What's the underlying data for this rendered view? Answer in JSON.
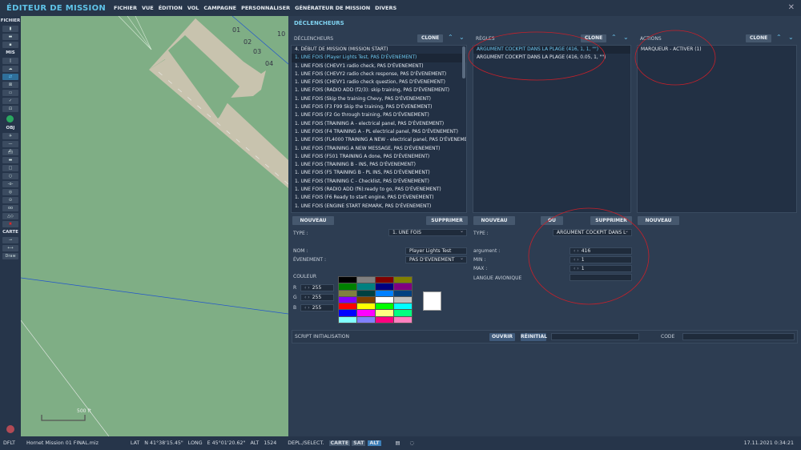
{
  "app": {
    "title": "ÉDITEUR DE MISSION",
    "menu": [
      "FICHIER",
      "VUE",
      "ÉDITION",
      "VOL",
      "CAMPAGNE",
      "PERSONNALISER",
      "GÉNÉRATEUR DE MISSION",
      "DIVERS"
    ],
    "close": "✕"
  },
  "toolbar": {
    "fichier": "FICHIER",
    "mis": "MIS",
    "obj": "OBJ",
    "carte": "CARTE",
    "draw": "Draw"
  },
  "map": {
    "parking": [
      "01",
      "02",
      "03",
      "04",
      "10"
    ],
    "scale": "500 ft"
  },
  "panel": {
    "title": "DÉCLENCHEURS",
    "triggers": {
      "label": "DÉCLENCHEURS",
      "clone": "CLONE",
      "items": [
        "4. DÉBUT DE MISSION (MISSION START)",
        "1. UNE FOIS (Player Lights Test, PAS D'ÉVENEMENT)",
        "1. UNE FOIS (CHEVY1 radio check, PAS D'ÉVENEMENT)",
        "1. UNE FOIS (CHEVY2 radio check response, PAS D'ÉVENEMENT)",
        "1. UNE FOIS (CHEVY1 radio check question, PAS D'ÉVENEMENT)",
        "1. UNE FOIS (RADIO ADD (f2/3): skip training, PAS D'ÉVENEMENT)",
        "1. UNE FOIS (Skip the training Chevy, PAS D'ÉVENEMENT)",
        "1. UNE FOIS (F3 F99 Skip the training, PAS D'ÉVENEMENT)",
        "1. UNE FOIS (F2 Go through training, PAS D'ÉVENEMENT)",
        "1. UNE FOIS (TRAINING A - electrical panel, PAS D'ÉVENEMENT)",
        "1. UNE FOIS (F4 TRAINING A - PL electrical panel, PAS D'ÉVENEMENT)",
        "1. UNE FOIS (FL4000 TRAINING A NEW - electrical panel, PAS D'ÉVENEMENT)",
        "1. UNE FOIS (TRAINING A NEW MESSAGE, PAS D'ÉVENEMENT)",
        "1. UNE FOIS (F501 TRAINING A done, PAS D'ÉVENEMENT)",
        "1. UNE FOIS (TRAINING B - INS, PAS D'ÉVENEMENT)",
        "1. UNE FOIS (F5 TRAINING B - PL INS, PAS D'ÉVENEMENT)",
        "1. UNE FOIS (TRAINING C - Checklist, PAS D'ÉVENEMENT)",
        "1. UNE FOIS (RADIO ADD (f6):ready to go, PAS D'ÉVENEMENT)",
        "1. UNE FOIS (F6 Ready to start engine, PAS D'ÉVENEMENT)",
        "1. UNE FOIS (ENGINE START REMARK, PAS D'ÉVENEMENT)"
      ],
      "selected": 1
    },
    "rules": {
      "label": "RÈGLES",
      "clone": "CLONE",
      "items": [
        "ARGUMENT COCKPIT DANS LA PLAGE (416, 1, 1, \"\")",
        "ARGUMENT COCKPIT DANS LA PLAGE (416, 0.05, 1, \"\")"
      ],
      "selected": 0
    },
    "actions": {
      "label": "ACTIONS",
      "clone": "CLONE",
      "items": [
        "MARQUEUR - ACTIVER (1)"
      ]
    },
    "buttons": {
      "new": "NOUVEAU",
      "delete": "SUPPRIMER",
      "or": "OU"
    },
    "trigger_form": {
      "type_label": "TYPE :",
      "type": "1. UNE FOIS",
      "name_label": "NOM :",
      "name": "Player Lights Test",
      "event_label": "ÉVENEMENT :",
      "event": "PAS D'ÉVENEMENT",
      "color_label": "COULEUR",
      "r_label": "R",
      "g_label": "G",
      "b_label": "B",
      "r": "255",
      "g": "255",
      "b": "255"
    },
    "palette": [
      "#000000",
      "#808080",
      "#800000",
      "#808000",
      "#008000",
      "#008080",
      "#000080",
      "#800080",
      "#808040",
      "#004040",
      "#0080ff",
      "#004080",
      "#8000ff",
      "#804000",
      "#ffffff",
      "#c0c0c0",
      "#ff0000",
      "#ffff00",
      "#00ff00",
      "#00ffff",
      "#0000ff",
      "#ff00ff",
      "#ffff80",
      "#00ff80",
      "#80ffff",
      "#8080ff",
      "#ff0080",
      "#ff80c0"
    ],
    "rule_form": {
      "type_label": "TYPE :",
      "type": "ARGUMENT COCKPIT DANS L",
      "argument_label": "argument :",
      "argument": "416",
      "min_label": "MIN :",
      "min": "1",
      "max_label": "MAX :",
      "max": "1",
      "avionics_label": "LANGUE AVIONIQUE",
      "avionics": ""
    },
    "script": {
      "label": "SCRIPT INITIALISATION",
      "open": "OUVRIR",
      "reset": "RÉINITIAL",
      "code_label": "CODE",
      "value": "",
      "code": ""
    }
  },
  "status": {
    "mode": "DFLT",
    "file": "Hornet Mission 01 FINAL.miz",
    "lat_label": "LAT",
    "lat": "N 41°38'15.45\"",
    "long_label": "LONG",
    "long": "E 45°01'20.62\"",
    "alt_label": "ALT",
    "alt": "1524",
    "move_label": "DEPL./SELECT.",
    "carte": "CARTE",
    "sat": "SAT",
    "alt_btn": "ALT",
    "datetime": "17.11.2021 0:34:21"
  }
}
